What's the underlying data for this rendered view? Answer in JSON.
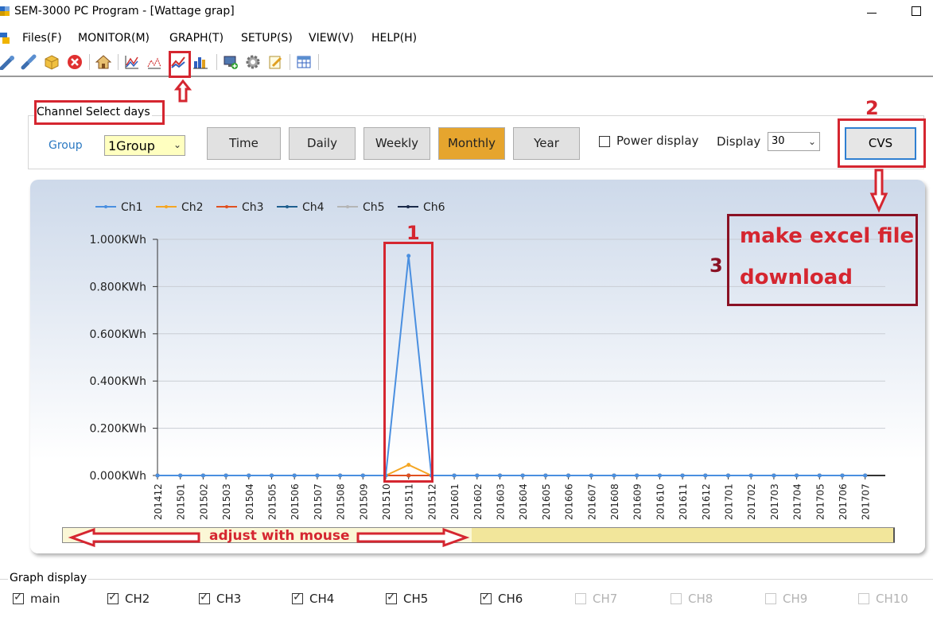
{
  "window": {
    "title": "SEM-3000 PC Program - [Wattage grap]"
  },
  "menu": [
    "Files(F)",
    "MONITOR(M)",
    "GRAPH(T)",
    "SETUP(S)",
    "VIEW(V)",
    "HELP(H)"
  ],
  "toolbar_icons": [
    "connect-icon",
    "disconnect-icon",
    "package-icon",
    "stop-icon",
    "home-icon",
    "graph-icon",
    "wave-icon",
    "line-graph-icon",
    "bar-graph-icon",
    "monitor-add-icon",
    "settings-icon",
    "edit-icon",
    "table-icon"
  ],
  "controls": {
    "legend": "Channel Select days",
    "group_label": "Group",
    "group_value": "1Group",
    "periods": [
      "Time",
      "Daily",
      "Weekly",
      "Monthly",
      "Year"
    ],
    "active_period": "Monthly",
    "power_display_label": "Power display",
    "power_display_checked": false,
    "display_label": "Display",
    "display_value": "30",
    "cvs_label": "CVS"
  },
  "chart_data": {
    "type": "line",
    "y_tick_labels": [
      "1.000KWh",
      "0.800KWh",
      "0.600KWh",
      "0.400KWh",
      "0.200KWh",
      "0.000KWh"
    ],
    "ylim": [
      0,
      1.0
    ],
    "categories": [
      "201412",
      "201501",
      "201502",
      "201503",
      "201504",
      "201505",
      "201506",
      "201507",
      "201508",
      "201509",
      "201510",
      "201511",
      "201512",
      "201601",
      "201602",
      "201603",
      "201604",
      "201605",
      "201606",
      "201607",
      "201608",
      "201609",
      "201610",
      "201611",
      "201612",
      "201701",
      "201702",
      "201703",
      "201704",
      "201705",
      "201706",
      "201707"
    ],
    "legend_position": "top-left",
    "series": [
      {
        "name": "Ch1",
        "color": "#4a8fe0",
        "spike": {
          "category": "201511",
          "value": 0.93
        }
      },
      {
        "name": "Ch2",
        "color": "#f5a623",
        "spike": {
          "category": "201511",
          "value": 0.045
        }
      },
      {
        "name": "Ch3",
        "color": "#e05020",
        "spike": null
      },
      {
        "name": "Ch4",
        "color": "#1f5f8f",
        "spike": null
      },
      {
        "name": "Ch5",
        "color": "#b5b5b5",
        "spike": null
      },
      {
        "name": "Ch6",
        "color": "#1a2a4a",
        "spike": null
      }
    ]
  },
  "graph_display": {
    "title": "Graph display",
    "items": [
      {
        "label": "main",
        "checked": true,
        "enabled": true
      },
      {
        "label": "CH2",
        "checked": true,
        "enabled": true
      },
      {
        "label": "CH3",
        "checked": true,
        "enabled": true
      },
      {
        "label": "CH4",
        "checked": true,
        "enabled": true
      },
      {
        "label": "CH5",
        "checked": true,
        "enabled": true
      },
      {
        "label": "CH6",
        "checked": true,
        "enabled": true
      },
      {
        "label": "CH7",
        "checked": false,
        "enabled": false
      },
      {
        "label": "CH8",
        "checked": false,
        "enabled": false
      },
      {
        "label": "CH9",
        "checked": false,
        "enabled": false
      },
      {
        "label": "CH10",
        "checked": false,
        "enabled": false
      }
    ]
  },
  "annotations": {
    "n1": "1",
    "n2": "2",
    "n3": "3",
    "excel_line1": "make excel file",
    "excel_line2": "download",
    "mouse": "adjust with mouse"
  }
}
